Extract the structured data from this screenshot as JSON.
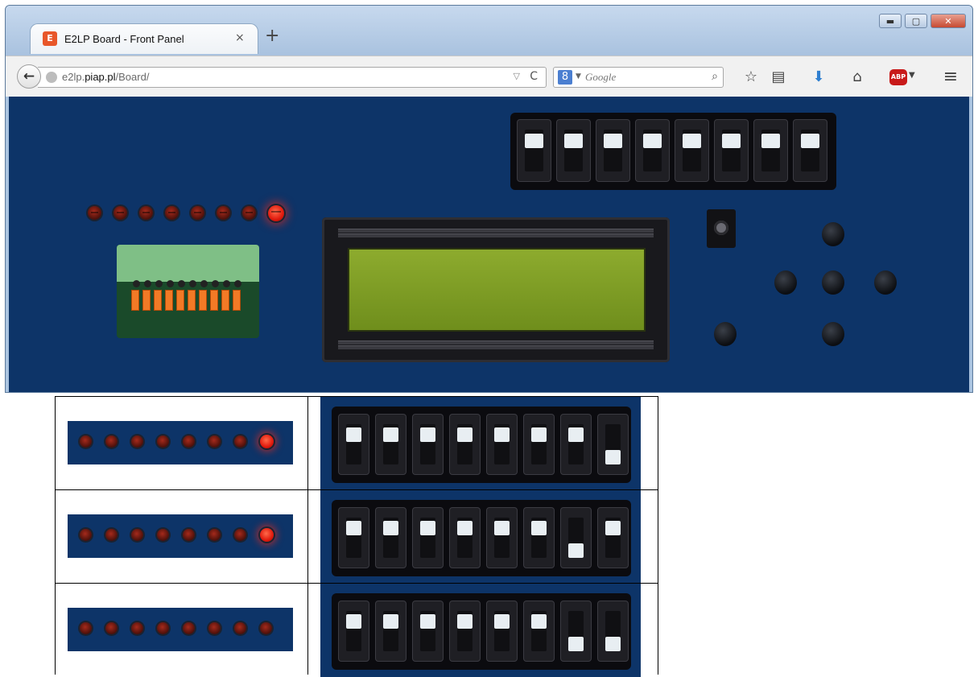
{
  "browser": {
    "tab_title": "E2LP Board - Front Panel",
    "tab_close": "×",
    "new_tab": "+",
    "favicon_glyph": "E",
    "url_prefix": "e2lp.",
    "url_host": "piap.pl",
    "url_path": "/Board/",
    "search_engine_glyph": "8",
    "search_placeholder": "Google",
    "window_buttons": {
      "minimize": "▬",
      "maximize": "▢",
      "close": "✕"
    },
    "toolbar_glyphs": {
      "back": "←",
      "bookmark": "☆",
      "reader": "▤",
      "download": "⬇",
      "home": "⌂",
      "menu": "≡",
      "search_go": "⌕",
      "reload": "C",
      "dropdown": "▽",
      "caret": "▼"
    },
    "abp_label": "ABP"
  },
  "board": {
    "leds": [
      false,
      false,
      false,
      false,
      false,
      false,
      false,
      true
    ],
    "switches_up": [
      true,
      true,
      true,
      true,
      true,
      true,
      true,
      true
    ]
  },
  "states": [
    {
      "leds": [
        false,
        false,
        false,
        false,
        false,
        false,
        false,
        true
      ],
      "switches_up": [
        true,
        true,
        true,
        true,
        true,
        true,
        true,
        false
      ]
    },
    {
      "leds": [
        false,
        false,
        false,
        false,
        false,
        false,
        false,
        true
      ],
      "switches_up": [
        true,
        true,
        true,
        true,
        true,
        true,
        false,
        true
      ]
    },
    {
      "leds": [
        false,
        false,
        false,
        false,
        false,
        false,
        false,
        false
      ],
      "switches_up": [
        true,
        true,
        true,
        true,
        true,
        true,
        false,
        false
      ]
    }
  ],
  "colors": {
    "board_blue": "#0d3468",
    "led_on": "#ff2a14",
    "lcd_green": "#7f9d26"
  }
}
